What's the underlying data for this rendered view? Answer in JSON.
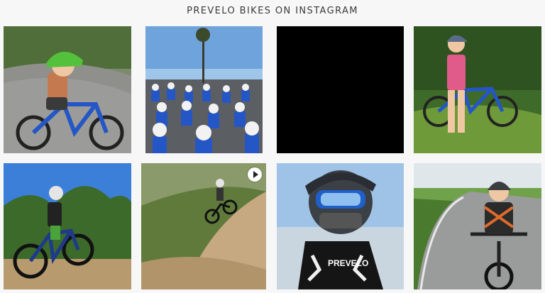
{
  "header": {
    "title": "PREVELO BIKES ON INSTAGRAM"
  },
  "posts": [
    {
      "subject": "Toddler in green helmet riding blue balance-style bike on paved path",
      "type": "photo"
    },
    {
      "subject": "Large group of kids on blue bikes lined up by the ocean",
      "type": "photo"
    },
    {
      "subject": "Blank black post",
      "type": "photo"
    },
    {
      "subject": "Girl in pink shirt standing with blue bike on grass",
      "type": "photo"
    },
    {
      "subject": "Kid riding blue mountain bike on trail under blue sky",
      "type": "photo"
    },
    {
      "subject": "Kid riding dirt jumps on a trail",
      "type": "video",
      "badge_icon": "play-icon"
    },
    {
      "subject": "Close-up of rider in blue full-face helmet and goggles",
      "type": "photo",
      "shirt_text": "PREVELO"
    },
    {
      "subject": "Smiling boy on pump track with black bike",
      "type": "photo"
    }
  ],
  "colors": {
    "background": "#f7f7f8",
    "accent_blue": "#2457c5",
    "title_text": "#3a3a3a"
  }
}
